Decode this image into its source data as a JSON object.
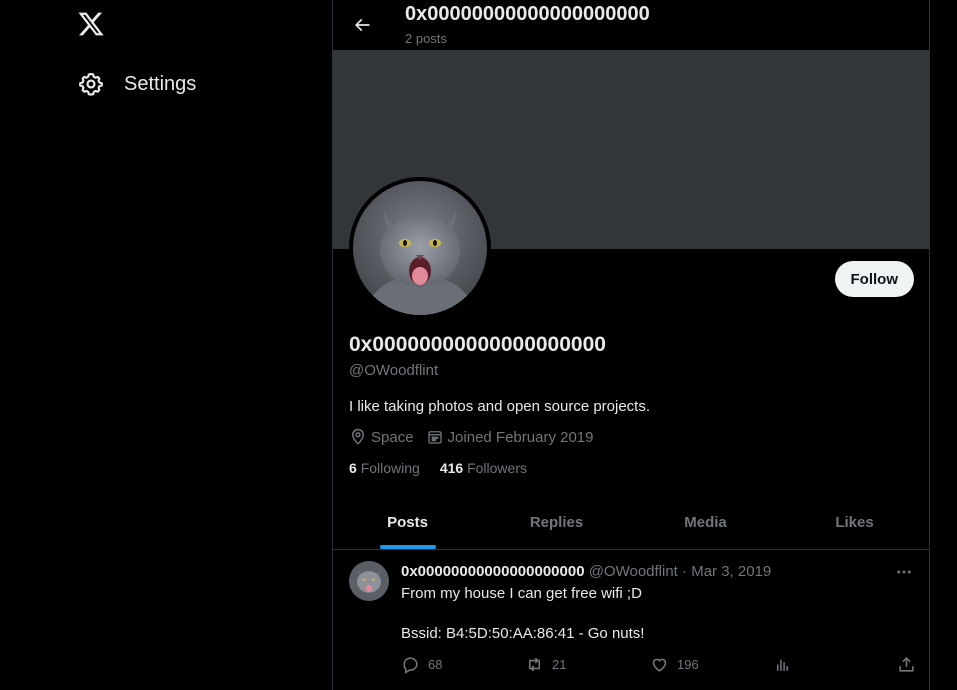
{
  "sidebar": {
    "logo_icon": "x-logo-icon",
    "settings_label": "Settings",
    "settings_icon": "gear-icon"
  },
  "header": {
    "back_icon": "arrow-left-icon",
    "title": "0x00000000000000000000",
    "subtitle": "2 posts"
  },
  "profile": {
    "banner_color": "#333639",
    "avatar_description": "grey-cat-avatar",
    "follow_label": "Follow",
    "display_name": "0x00000000000000000000",
    "handle": "@OWoodflint",
    "bio": "I like taking photos and open source projects.",
    "location": "Space",
    "location_icon": "location-pin-icon",
    "joined": "Joined February 2019",
    "joined_icon": "calendar-icon",
    "following_count": "6",
    "following_label": "Following",
    "followers_count": "416",
    "followers_label": "Followers"
  },
  "tabs": [
    {
      "label": "Posts",
      "active": true
    },
    {
      "label": "Replies",
      "active": false
    },
    {
      "label": "Media",
      "active": false
    },
    {
      "label": "Likes",
      "active": false
    }
  ],
  "post": {
    "author_name": "0x00000000000000000000",
    "author_handle": "@OWoodflint",
    "separator": "·",
    "date": "Mar 3, 2019",
    "text_line1": "From my house I can get free wifi ;D",
    "text_line2": "Bssid: B4:5D:50:AA:86:41 - Go nuts!",
    "replies": "68",
    "reposts": "21",
    "likes": "196",
    "more_icon": "more-dots-icon"
  },
  "colors": {
    "background": "#000000",
    "text": "#e7e9ea",
    "secondary_text": "#71767b",
    "accent": "#1d9bf0",
    "border": "#2f3336"
  }
}
